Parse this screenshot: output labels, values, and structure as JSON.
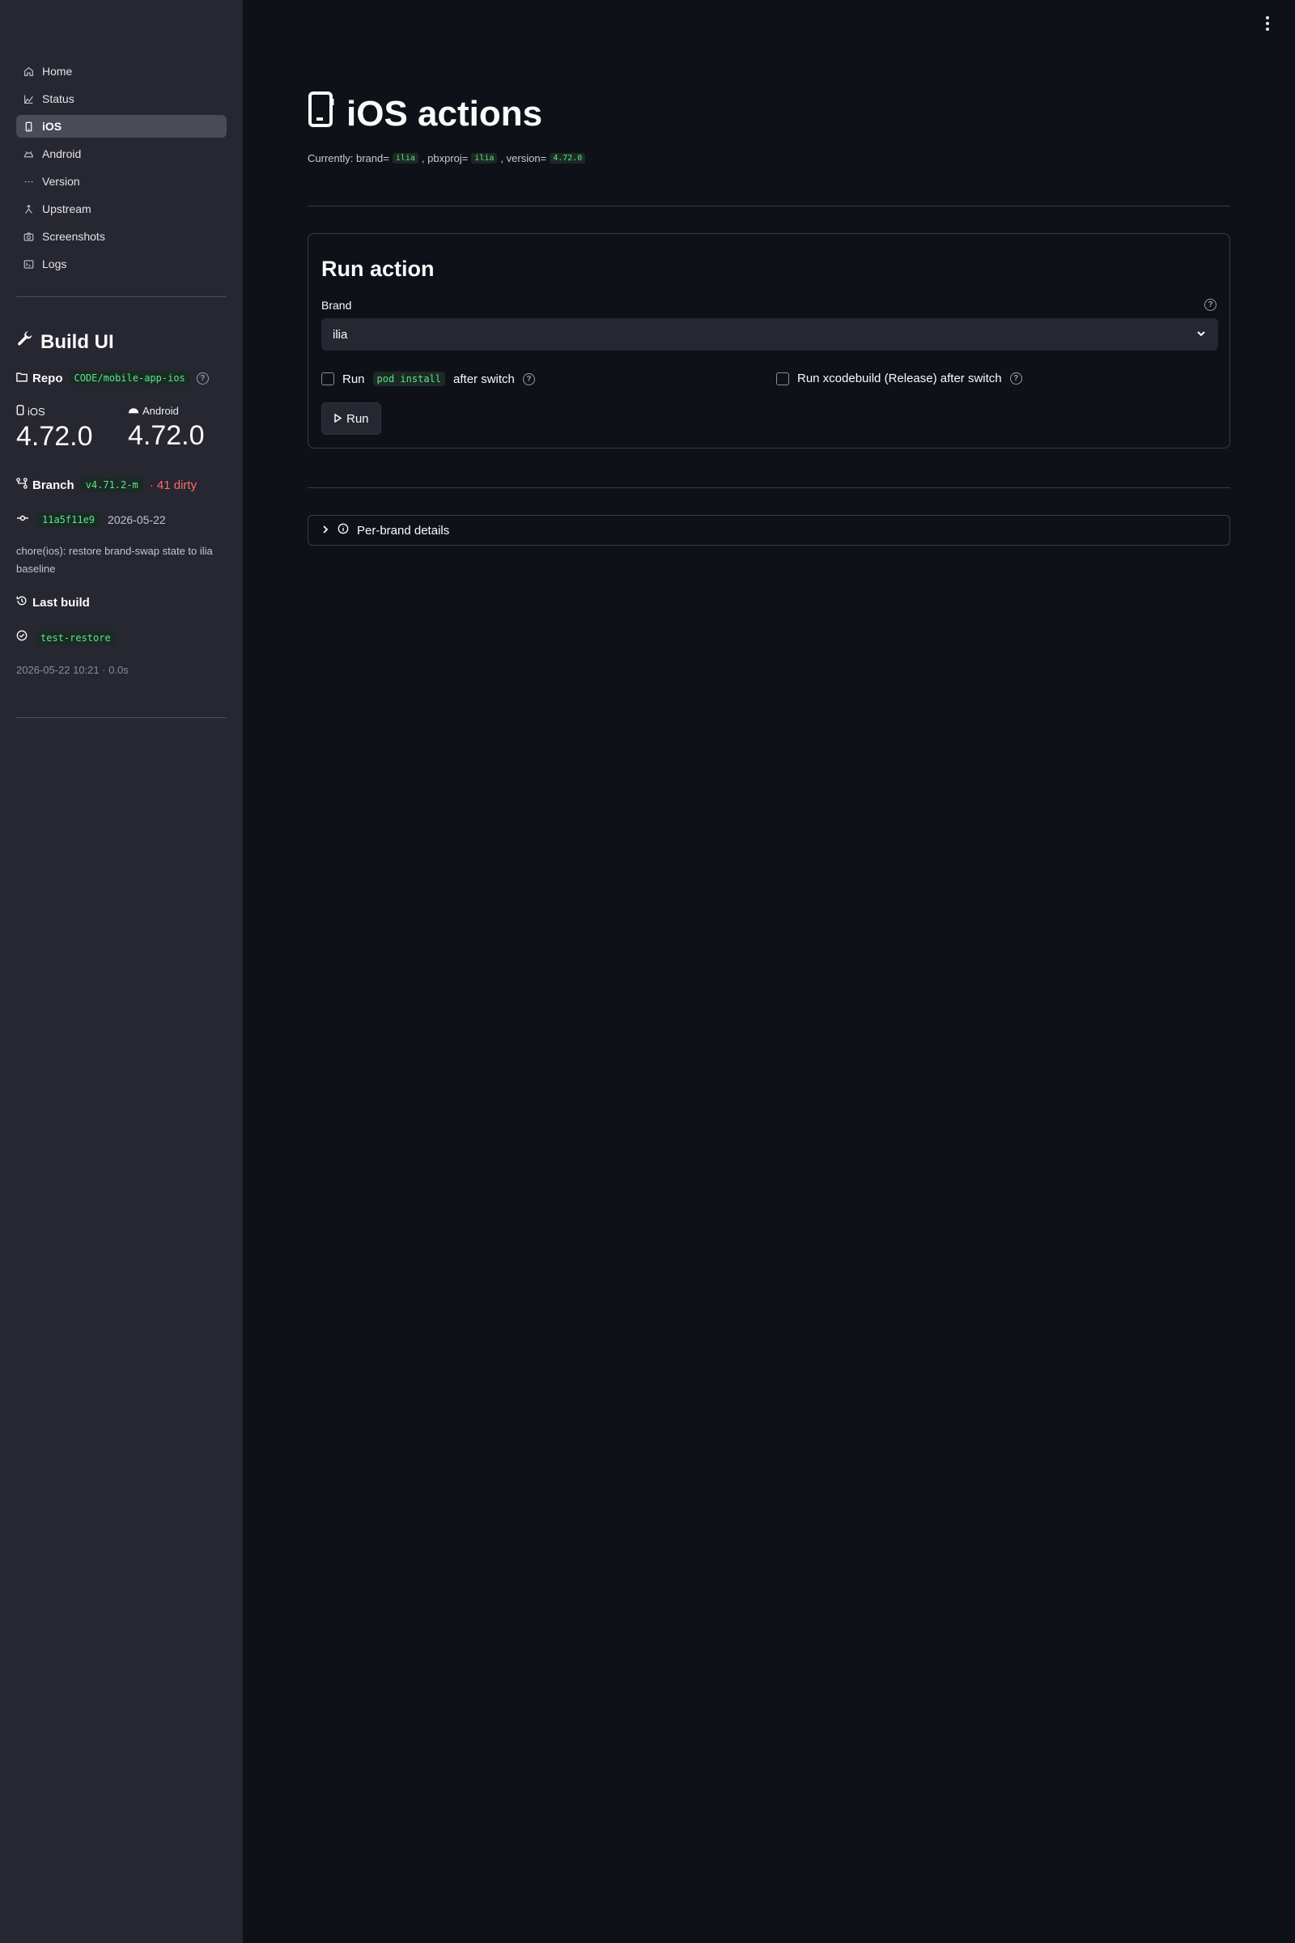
{
  "sidebar": {
    "nav": [
      {
        "label": "Home",
        "icon": "home-icon",
        "active": false
      },
      {
        "label": "Status",
        "icon": "chart-icon",
        "active": false
      },
      {
        "label": "iOS",
        "icon": "phone-icon",
        "active": true
      },
      {
        "label": "Android",
        "icon": "android-icon",
        "active": false
      },
      {
        "label": "Version",
        "icon": "version-icon",
        "active": false
      },
      {
        "label": "Upstream",
        "icon": "merge-icon",
        "active": false
      },
      {
        "label": "Screenshots",
        "icon": "camera-icon",
        "active": false
      },
      {
        "label": "Logs",
        "icon": "terminal-icon",
        "active": false
      }
    ],
    "title": "Build UI",
    "repo": {
      "label": "Repo",
      "value": "CODE/mobile-app-ios"
    },
    "ios": {
      "label": "iOS",
      "value": "4.72.0"
    },
    "android": {
      "label": "Android",
      "value": "4.72.0"
    },
    "branch": {
      "label": "Branch",
      "value": "v4.71.2-m",
      "dirty": "· 41 dirty"
    },
    "commit": {
      "hash": "11a5f11e9",
      "date": "2026-05-22",
      "message": "chore(ios): restore brand-swap state to ilia baseline"
    },
    "last_build": {
      "label": "Last build",
      "name": "test-restore",
      "meta": "2026-05-22 10:21 · 0.0s"
    }
  },
  "main": {
    "title": "iOS actions",
    "currently": {
      "prefix": "Currently: brand=",
      "brand": "ilia",
      "pbx_label": ", pbxproj=",
      "pbxproj": "ilia",
      "ver_label": ", version=",
      "version": "4.72.0"
    },
    "card": {
      "title": "Run action",
      "brand_label": "Brand",
      "brand_value": "ilia",
      "pod": {
        "pre": "Run",
        "code": "pod install",
        "post": "after switch"
      },
      "xcode_label": "Run xcodebuild (Release) after switch",
      "run_label": "Run"
    },
    "expander_label": "Per-brand details"
  }
}
